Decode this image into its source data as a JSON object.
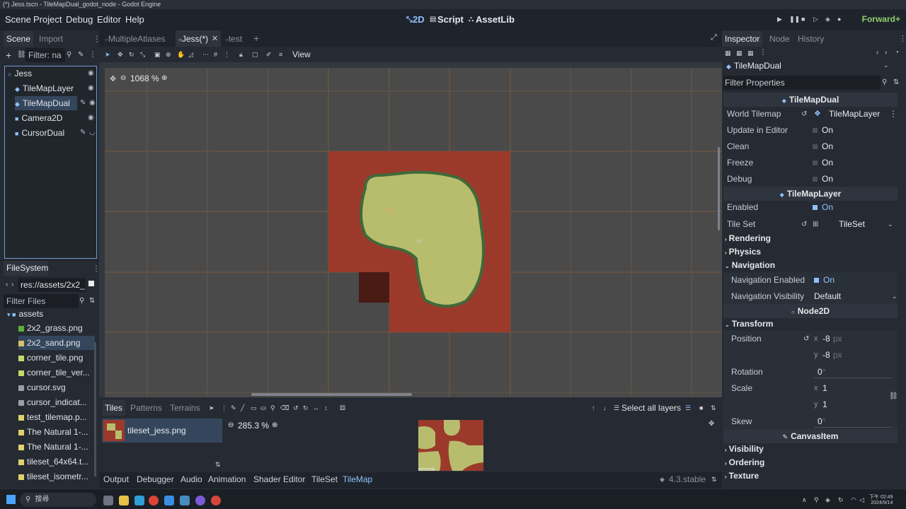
{
  "window_title": "(*) Jess.tscn - TileMapDual_godot_node - Godot Engine",
  "menu": [
    "Scene",
    "Project",
    "Debug",
    "Editor",
    "Help"
  ],
  "workspaces": [
    "2D",
    "Script",
    "AssetLib"
  ],
  "renderer": "Forward+",
  "scene_dock": {
    "tabs": [
      "Scene",
      "Import"
    ],
    "filter_placeholder": "Filter: na",
    "nodes": [
      {
        "name": "Jess"
      },
      {
        "name": "TileMapLayer"
      },
      {
        "name": "TileMapDual"
      },
      {
        "name": "Camera2D"
      },
      {
        "name": "CursorDual"
      }
    ]
  },
  "filesystem": {
    "title": "FileSystem",
    "path": "res://assets/2x2_",
    "filter_placeholder": "Filter Files",
    "folder": "assets",
    "files": [
      {
        "name": "2x2_grass.png",
        "color": "#5fae3a"
      },
      {
        "name": "2x2_sand.png",
        "color": "#d6c26a"
      },
      {
        "name": "corner_tile.png",
        "color": "#c7d86a"
      },
      {
        "name": "corner_tile_ver...",
        "color": "#c7d86a"
      },
      {
        "name": "cursor.svg",
        "color": "#9aa0a8"
      },
      {
        "name": "cursor_indicat...",
        "color": "#9aa0a8"
      },
      {
        "name": "test_tilemap.p...",
        "color": "#e0d36a"
      },
      {
        "name": "The Natural 1-...",
        "color": "#e0d36a"
      },
      {
        "name": "The Natural 1-...",
        "color": "#e0d36a"
      },
      {
        "name": "tileset_64x64.t...",
        "color": "#e0d36a"
      },
      {
        "name": "tileset_isometr...",
        "color": "#e0d36a"
      }
    ]
  },
  "editor_tabs": [
    "MultipleAtlases",
    "Jess(*)",
    "test"
  ],
  "toolbar": {
    "view_label": "View"
  },
  "zoom": "1068 %",
  "bottom_panel": {
    "tabs": [
      "Tiles",
      "Patterns",
      "Terrains"
    ],
    "select_all_layers": "Select all layers",
    "tileset_item": "tileset_jess.png",
    "zoom": "285.3 %"
  },
  "bottom_tabs": [
    "Output",
    "Debugger",
    "Audio",
    "Animation",
    "Shader Editor",
    "TileSet",
    "TileMap"
  ],
  "version": "4.3.stable",
  "inspector": {
    "tabs": [
      "Inspector",
      "Node",
      "History"
    ],
    "node_name": "TileMapDual",
    "filter_placeholder": "Filter Properties",
    "header_tilemapdual": "TileMapDual",
    "world_tilemap_label": "World Tilemap",
    "world_tilemap_value": "TileMapLayer",
    "update_label": "Update in Editor",
    "clean_label": "Clean",
    "freeze_label": "Freeze",
    "debug_label": "Debug",
    "on": "On",
    "header_tilemaplayer": "TileMapLayer",
    "enabled_label": "Enabled",
    "tileset_label": "Tile Set",
    "tileset_value": "TileSet",
    "rendering": "Rendering",
    "physics": "Physics",
    "navigation": "Navigation",
    "nav_enabled_label": "Navigation Enabled",
    "nav_visibility_label": "Navigation Visibility",
    "nav_visibility_value": "Default",
    "header_node2d": "Node2D",
    "transform": "Transform",
    "position_label": "Position",
    "pos_x": "-8",
    "pos_y": "-8",
    "px": "px",
    "rotation_label": "Rotation",
    "rotation_value": "0",
    "scale_label": "Scale",
    "scale_x": "1",
    "scale_y": "1",
    "skew_label": "Skew",
    "skew_value": "0",
    "header_canvasitem": "CanvasItem",
    "visibility": "Visibility",
    "ordering": "Ordering",
    "texture": "Texture",
    "x": "x",
    "y": "y",
    "degree": "°"
  },
  "taskbar": {
    "search_placeholder": "搜尋",
    "time": "下午 02:49",
    "date": "2024/9/14"
  }
}
